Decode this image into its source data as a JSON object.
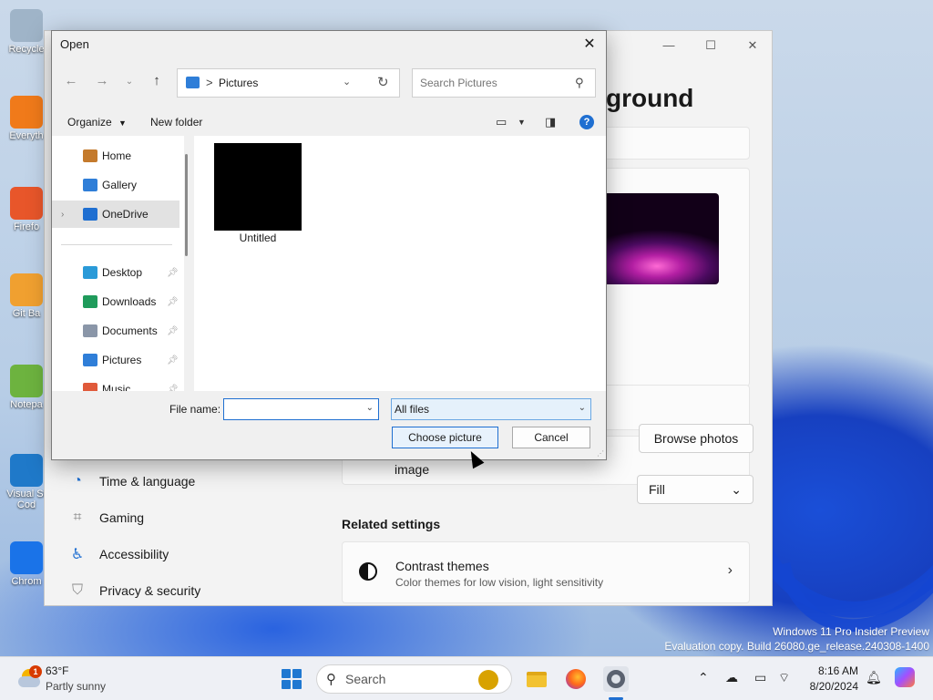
{
  "desktop": {
    "icons": [
      {
        "label": "Recycle",
        "icon": "recycle-bin-icon",
        "color": "#9fb4c8"
      },
      {
        "label": "Everyth",
        "icon": "everything-search-icon",
        "color": "#f07a1a"
      },
      {
        "label": "Firefo",
        "icon": "firefox-icon",
        "color": "#e8562a"
      },
      {
        "label": "Git Ba",
        "icon": "git-bash-icon",
        "color": "#f0a030"
      },
      {
        "label": "Notepa",
        "icon": "notepad-plus-icon",
        "color": "#6db33f"
      },
      {
        "label": "Visual St\nCod",
        "icon": "vscode-icon",
        "color": "#1f79c9"
      },
      {
        "label": "Chrom",
        "icon": "chrome-icon",
        "color": "#1a73e8"
      }
    ],
    "watermark": {
      "line1": "Windows 11 Pro Insider Preview",
      "line2": "Evaluation copy. Build 26080.ge_release.240308-1400"
    }
  },
  "settings": {
    "heading": "ground",
    "browse_button": "Browse photos",
    "fit_dropdown": "Fill",
    "image_label": "image",
    "nav": [
      {
        "label": "Time & language",
        "icon": "globe-clock-icon"
      },
      {
        "label": "Gaming",
        "icon": "gamepad-icon"
      },
      {
        "label": "Accessibility",
        "icon": "accessibility-icon"
      },
      {
        "label": "Privacy & security",
        "icon": "shield-icon"
      }
    ],
    "related_settings": "Related settings",
    "contrast": {
      "title": "Contrast themes",
      "subtitle": "Color themes for low vision, light sensitivity"
    }
  },
  "dialog": {
    "title": "Open",
    "address": {
      "path": "Pictures",
      "separator": ">"
    },
    "search": {
      "placeholder": "Search Pictures"
    },
    "toolbar": {
      "organize": "Organize",
      "new_folder": "New folder",
      "help": "?"
    },
    "nav_items": [
      {
        "label": "Home",
        "icon": "home-icon",
        "color": "#c47a2c",
        "pinned": false,
        "expand": false
      },
      {
        "label": "Gallery",
        "icon": "gallery-icon",
        "color": "#2f7ed8",
        "pinned": false,
        "expand": false
      },
      {
        "label": "OneDrive",
        "icon": "onedrive-icon",
        "color": "#1f6fd1",
        "pinned": false,
        "expand": true,
        "selected": true
      },
      {
        "label": "Desktop",
        "icon": "desktop-icon",
        "color": "#2a9ad8",
        "pinned": true
      },
      {
        "label": "Downloads",
        "icon": "downloads-icon",
        "color": "#1f9b5b",
        "pinned": true
      },
      {
        "label": "Documents",
        "icon": "documents-icon",
        "color": "#8a96a8",
        "pinned": true
      },
      {
        "label": "Pictures",
        "icon": "pictures-icon",
        "color": "#2f7ed8",
        "pinned": true
      },
      {
        "label": "Music",
        "icon": "music-icon",
        "color": "#e05a3a",
        "pinned": true
      }
    ],
    "files": [
      {
        "name": "Untitled",
        "thumb_color": "#000000"
      }
    ],
    "file_name_label": "File name:",
    "file_name_value": "",
    "file_type": "All files",
    "choose_button": "Choose picture",
    "cancel_button": "Cancel"
  },
  "taskbar": {
    "weather": {
      "temp": "63°F",
      "desc": "Partly sunny",
      "badge": "1"
    },
    "search_label": "Search",
    "clock": {
      "time": "8:16 AM",
      "date": "8/20/2024"
    },
    "accent": "#1f6fd1"
  }
}
